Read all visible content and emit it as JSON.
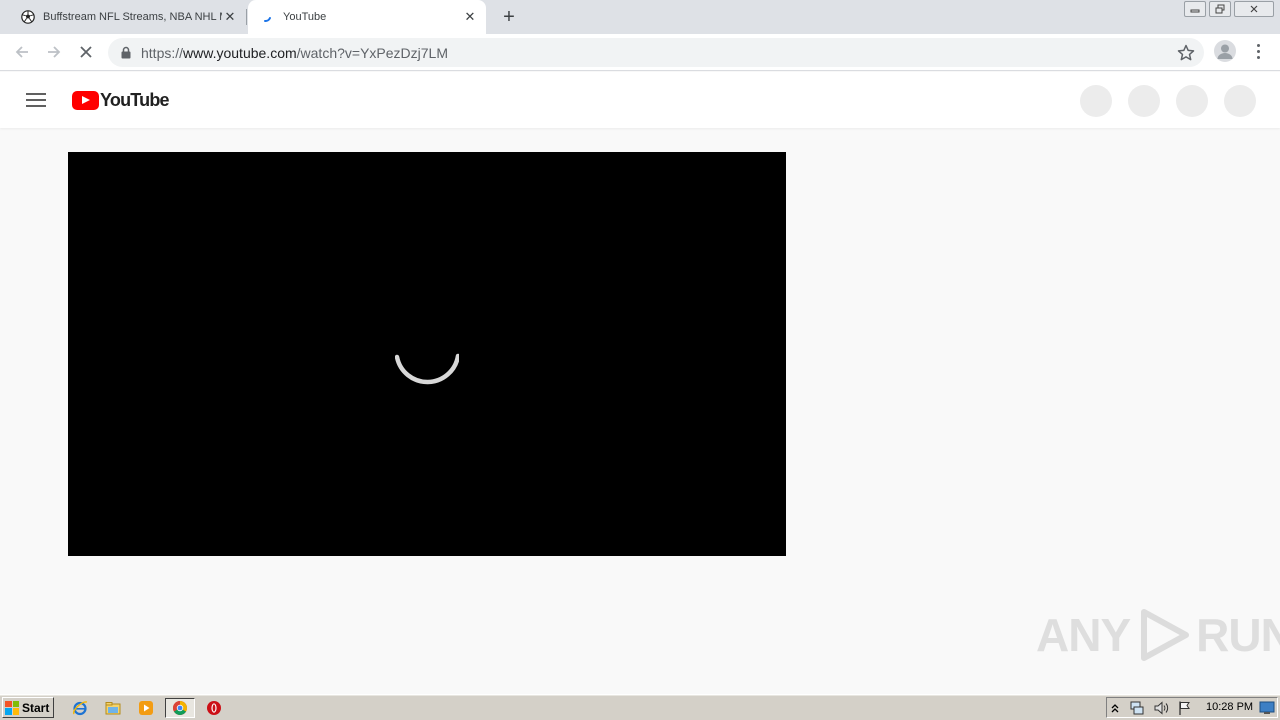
{
  "browser": {
    "tabs": [
      {
        "title": "Buffstream NFL Streams, NBA NHL M",
        "favicon": "soccer-ball-icon",
        "active": false
      },
      {
        "title": "YouTube",
        "favicon": "loading-spinner-icon",
        "active": true
      }
    ],
    "url": {
      "scheme": "https://",
      "host": "www.youtube.com",
      "path": "/watch?v=YxPezDzj7LM"
    }
  },
  "youtube": {
    "logo_text": "YouTube",
    "player_state": "loading"
  },
  "watermark": {
    "left": "ANY",
    "right": "RUN"
  },
  "taskbar": {
    "start_label": "Start",
    "clock": "10:28 PM",
    "pinned": [
      "ie-icon",
      "explorer-icon",
      "media-player-icon",
      "chrome-icon",
      "opera-icon"
    ]
  },
  "colors": {
    "yt_red": "#ff0000",
    "tab_strip": "#dee1e6",
    "taskbar": "#d4d0c8"
  }
}
